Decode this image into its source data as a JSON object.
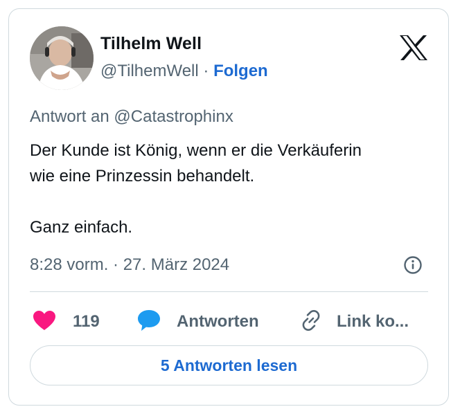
{
  "author": {
    "name": "Tilhelm Well",
    "handle": "@TilhemWell",
    "separator": "·",
    "follow_label": "Folgen"
  },
  "tweet": {
    "reply_to": "Antwort an @Catastrophinx",
    "paragraph_1_line_1": "Der Kunde ist König, wenn er die Verkäuferin",
    "paragraph_1_line_2": "wie eine Prinzessin behandelt.",
    "paragraph_2": "Ganz einfach.",
    "timestamp": "8:28 vorm. · 27. März 2024"
  },
  "actions": {
    "like_count": "119",
    "reply_label": "Antworten",
    "copy_link_label": "Link ko..."
  },
  "read_replies_label": "5 Antworten lesen",
  "icons": {
    "logo": "x-logo-icon",
    "info": "info-icon",
    "like": "heart-icon",
    "reply": "speech-bubble-icon",
    "copy": "link-icon"
  },
  "colors": {
    "accent": "#1d6ad1",
    "like": "#f91880",
    "reply_icon": "#1d9bf0",
    "muted_text": "#536471",
    "border": "#cfd9de"
  }
}
